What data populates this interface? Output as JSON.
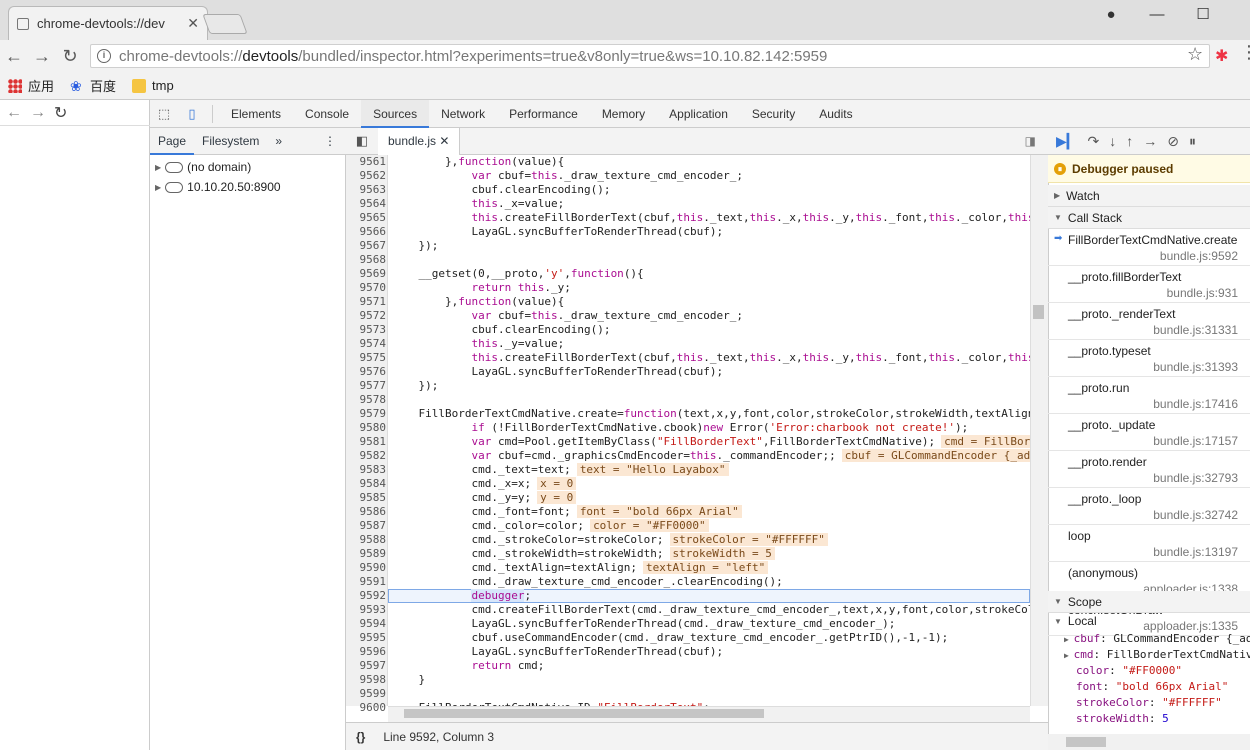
{
  "browser": {
    "tab_title": "chrome-devtools://dev",
    "url_prefix": "chrome-devtools://",
    "url_host": "devtools",
    "url_rest": "/bundled/inspector.html?experiments=true&v8only=true&ws=10.10.82.142:5959",
    "bookmarks": [
      {
        "label": "应用",
        "icon": "apps-icon"
      },
      {
        "label": "百度",
        "icon": "baidu-icon"
      },
      {
        "label": "tmp",
        "icon": "folder-icon"
      }
    ]
  },
  "devtools": {
    "panels": [
      "Elements",
      "Console",
      "Sources",
      "Network",
      "Performance",
      "Memory",
      "Application",
      "Security",
      "Audits"
    ],
    "active_panel": "Sources",
    "navigator_tabs": [
      "Page",
      "Filesystem"
    ],
    "tree": [
      "(no domain)",
      "10.10.20.50:8900"
    ],
    "open_file": "bundle.js",
    "status": "Line 9592, Column 3",
    "status_braces": "{}"
  },
  "code_lines": [
    {
      "n": "9561",
      "t": "        },function(value){"
    },
    {
      "n": "9562",
      "t": "            var cbuf=this._draw_texture_cmd_encoder_;"
    },
    {
      "n": "9563",
      "t": "            cbuf.clearEncoding();"
    },
    {
      "n": "9564",
      "t": "            this._x=value;"
    },
    {
      "n": "9565",
      "t": "            this.createFillBorderText(cbuf,this._text,this._x,this._y,this._font,this._color,this._st"
    },
    {
      "n": "9566",
      "t": "            LayaGL.syncBufferToRenderThread(cbuf);"
    },
    {
      "n": "9567",
      "t": "    });"
    },
    {
      "n": "9568",
      "t": ""
    },
    {
      "n": "9569",
      "t": "    __getset(0,__proto,'y',function(){"
    },
    {
      "n": "9570",
      "t": "            return this._y;"
    },
    {
      "n": "9571",
      "t": "        },function(value){"
    },
    {
      "n": "9572",
      "t": "            var cbuf=this._draw_texture_cmd_encoder_;"
    },
    {
      "n": "9573",
      "t": "            cbuf.clearEncoding();"
    },
    {
      "n": "9574",
      "t": "            this._y=value;"
    },
    {
      "n": "9575",
      "t": "            this.createFillBorderText(cbuf,this._text,this._x,this._y,this._font,this._color,this._st"
    },
    {
      "n": "9576",
      "t": "            LayaGL.syncBufferToRenderThread(cbuf);"
    },
    {
      "n": "9577",
      "t": "    });"
    },
    {
      "n": "9578",
      "t": ""
    },
    {
      "n": "9579",
      "t": "    FillBorderTextCmdNative.create=function(text,x,y,font,color,strokeColor,strokeWidth,textAlign"
    },
    {
      "n": "9580",
      "t": "            if (!FillBorderTextCmdNative.cbook)new Error('Error:charbook not create!');"
    },
    {
      "n": "9581",
      "t": "            var cmd=Pool.getItemByClass(\"FillBorderText\",FillBorderTextCmdNative);",
      "v": "cmd = FillBorderT"
    },
    {
      "n": "9582",
      "t": "            var cbuf=cmd._graphicsCmdEncoder=this._commandEncoder;;",
      "v": "cbuf = GLCommandEncoder {_adjust"
    },
    {
      "n": "9583",
      "t": "            cmd._text=text;",
      "v": "text = \"Hello Layabox\""
    },
    {
      "n": "9584",
      "t": "            cmd._x=x;",
      "v": "x = 0"
    },
    {
      "n": "9585",
      "t": "            cmd._y=y;",
      "v": "y = 0"
    },
    {
      "n": "9586",
      "t": "            cmd._font=font;",
      "v": "font = \"bold 66px Arial\""
    },
    {
      "n": "9587",
      "t": "            cmd._color=color;",
      "v": "color = \"#FF0000\""
    },
    {
      "n": "9588",
      "t": "            cmd._strokeColor=strokeColor;",
      "v": "strokeColor = \"#FFFFFF\""
    },
    {
      "n": "9589",
      "t": "            cmd._strokeWidth=strokeWidth;",
      "v": "strokeWidth = 5"
    },
    {
      "n": "9590",
      "t": "            cmd._textAlign=textAlign;",
      "v": "textAlign = \"left\""
    },
    {
      "n": "9591",
      "t": "            cmd._draw_texture_cmd_encoder_.clearEncoding();"
    },
    {
      "n": "9592",
      "t": "            debugger;"
    },
    {
      "n": "9593",
      "t": "            cmd.createFillBorderText(cmd._draw_texture_cmd_encoder_,text,x,y,font,color,strokeColor,s"
    },
    {
      "n": "9594",
      "t": "            LayaGL.syncBufferToRenderThread(cmd._draw_texture_cmd_encoder_);"
    },
    {
      "n": "9595",
      "t": "            cbuf.useCommandEncoder(cmd._draw_texture_cmd_encoder_.getPtrID(),-1,-1);"
    },
    {
      "n": "9596",
      "t": "            LayaGL.syncBufferToRenderThread(cbuf);"
    },
    {
      "n": "9597",
      "t": "            return cmd;"
    },
    {
      "n": "9598",
      "t": "    }"
    },
    {
      "n": "9599",
      "t": ""
    },
    {
      "n": "9600",
      "t": "    FillBorderTextCmdNative.ID=\"FillBorderText\";"
    }
  ],
  "debugger": {
    "paused_label": "Debugger paused",
    "watch_label": "Watch",
    "callstack_label": "Call Stack",
    "scope_label": "Scope",
    "local_label": "Local",
    "frames": [
      {
        "fn": "FillBorderTextCmdNative.create",
        "loc": "bundle.js:9592"
      },
      {
        "fn": "__proto.fillBorderText",
        "loc": "bundle.js:931"
      },
      {
        "fn": "__proto._renderText",
        "loc": "bundle.js:31331"
      },
      {
        "fn": "__proto.typeset",
        "loc": "bundle.js:31393"
      },
      {
        "fn": "__proto.run",
        "loc": "bundle.js:17416"
      },
      {
        "fn": "__proto._update",
        "loc": "bundle.js:17157"
      },
      {
        "fn": "__proto.render",
        "loc": "bundle.js:32793"
      },
      {
        "fn": "__proto._loop",
        "loc": "bundle.js:32742"
      },
      {
        "fn": "loop",
        "loc": "bundle.js:13197"
      },
      {
        "fn": "(anonymous)",
        "loc": "apploader.js:1338"
      },
      {
        "fn": "conch.setOnDraw",
        "loc": "apploader.js:1335"
      }
    ],
    "scope": [
      {
        "k": "cbuf",
        "v": "GLCommandEncoder {_ad",
        "tri": true,
        "type": "obj"
      },
      {
        "k": "cmd",
        "v": "FillBorderTextCmdNativ",
        "tri": true,
        "type": "obj"
      },
      {
        "k": "color",
        "v": "\"#FF0000\"",
        "type": "str"
      },
      {
        "k": "font",
        "v": "\"bold 66px Arial\"",
        "type": "str"
      },
      {
        "k": "strokeColor",
        "v": "\"#FFFFFF\"",
        "type": "str"
      },
      {
        "k": "strokeWidth",
        "v": "5",
        "type": "num"
      }
    ]
  }
}
